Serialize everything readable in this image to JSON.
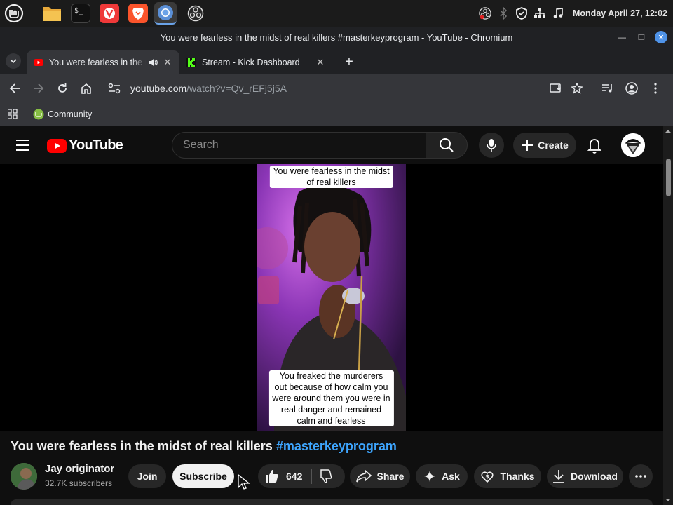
{
  "taskbar": {
    "apps": [
      "menu-icon",
      "files-icon",
      "terminal-icon",
      "vivaldi-icon",
      "brave-icon",
      "chromium-icon",
      "obs-icon"
    ],
    "datetime": "Monday April 27, 12:02"
  },
  "window": {
    "title": "You were fearless in the midst of real killers #masterkeyprogram - YouTube - Chromium"
  },
  "tabs": [
    {
      "title": "You were fearless in the midst of real killers",
      "active": true
    },
    {
      "title": "Stream - Kick Dashboard",
      "active": false
    }
  ],
  "omnibox": {
    "host": "youtube.com",
    "path": "/watch?v=Qv_rEFj5j5A"
  },
  "bookmarks": {
    "items": [
      {
        "label": "Community"
      }
    ]
  },
  "youtube": {
    "logo_text": "YouTube",
    "search_placeholder": "Search",
    "create_label": "Create",
    "video": {
      "caption_top": [
        "You were fearless in the midst",
        "of real killers"
      ],
      "caption_bottom": [
        "You freaked the murderers",
        "out because of how calm you",
        "were around them you were in",
        "real danger and remained",
        "calm and fearless"
      ],
      "title": "You were fearless in the midst of real killers",
      "hashtag": "#masterkeyprogram"
    },
    "channel": {
      "name": "Jay originator",
      "subscribers": "32.7K subscribers",
      "join_label": "Join",
      "subscribe_label": "Subscribe"
    },
    "actions": {
      "likes": "642",
      "share": "Share",
      "ask": "Ask",
      "thanks": "Thanks",
      "download": "Download"
    }
  },
  "colors": {
    "youtube_red": "#ff0000",
    "link_blue": "#3ea6ff",
    "kick_green": "#53fc18"
  }
}
